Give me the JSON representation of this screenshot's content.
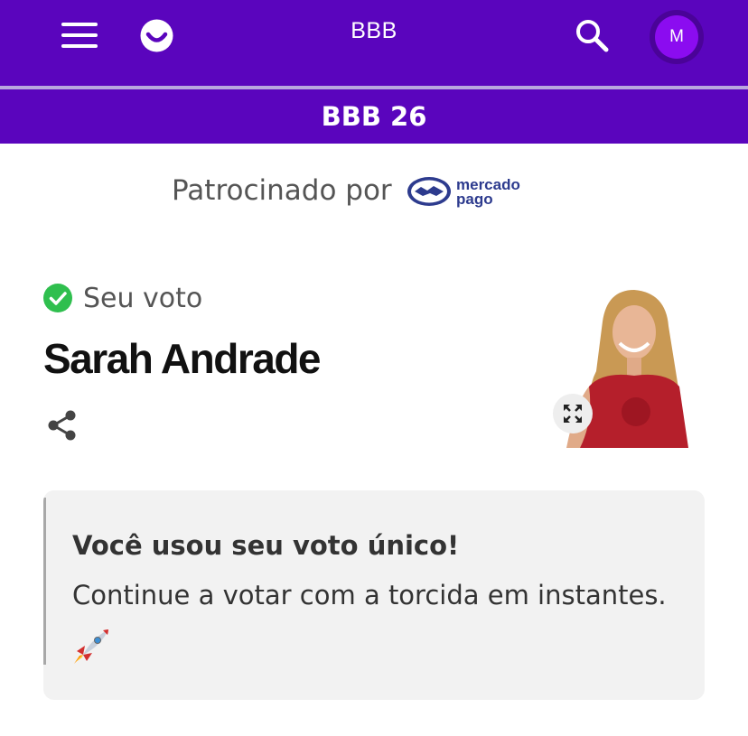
{
  "header": {
    "title": "BBB",
    "avatar_initial": "M",
    "menu_icon": "hamburger-menu-icon",
    "logo_icon": "smile-logo-icon",
    "search_icon": "search-icon",
    "brand_color": "#5a05bd"
  },
  "subheader": {
    "title": "BBB 26"
  },
  "sponsor": {
    "label": "Patrocinado por",
    "logo_text_1": "mercado",
    "logo_text_2": "pago"
  },
  "vote": {
    "status_label": "Seu voto",
    "status_icon": "check-circle-icon",
    "candidate_name": "Sarah Andrade",
    "share_icon": "share-icon",
    "expand_icon": "expand-icon"
  },
  "notice": {
    "title": "Você usou seu voto único!",
    "message": "Continue a votar com a torcida em instantes.",
    "emoji_icon": "rocket-icon"
  }
}
